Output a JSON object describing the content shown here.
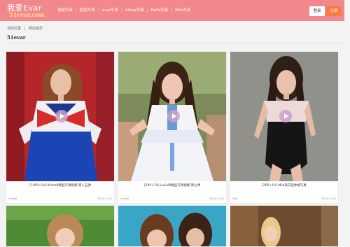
{
  "header": {
    "logo_top": "我爱Evar",
    "logo_bottom": "51evar.com",
    "nav": [
      "视频写真",
      "套图写真",
      "evar写真",
      "Alissa写真",
      "Bella写真",
      "Mila写真"
    ],
    "login": "登录",
    "register": "注册"
  },
  "breadcrumb": {
    "label": "当前位置",
    "sep": "|",
    "home": "网站首页"
  },
  "section": {
    "title": "51evar"
  },
  "cards": [
    {
      "caption": "[100P+1V] Khloe8精品写真视频 第十五弹",
      "author": "Khloe8",
      "date": "2020-11-24"
    },
    {
      "caption": "[50P+1V] Luriel8精品写真视频 第七弹",
      "author": "Luriel8",
      "date": "2020-11-24"
    },
    {
      "caption": "[29P+1V] Mila黑白连体裙写真",
      "author": "Mila",
      "date": "2020-11-24"
    }
  ],
  "colors": {
    "header": "#f2888d",
    "register": "#f57d43"
  }
}
